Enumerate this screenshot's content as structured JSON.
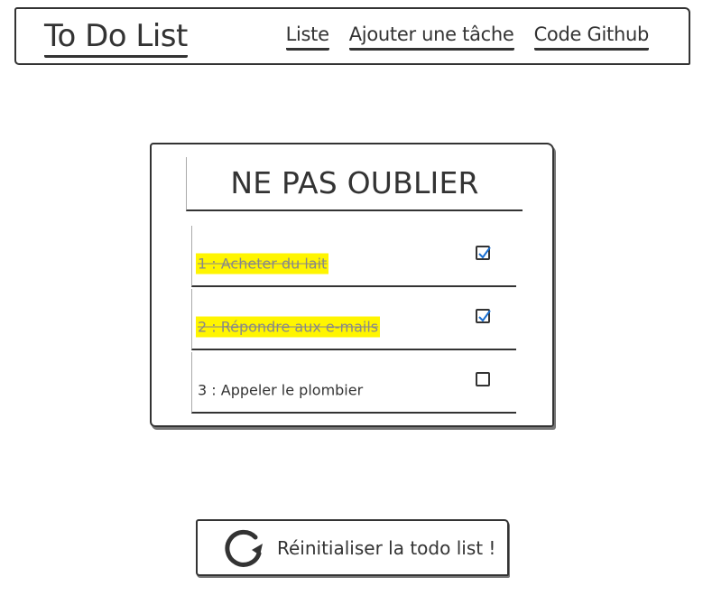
{
  "header": {
    "brand": "To Do List",
    "nav": [
      {
        "label": "Liste"
      },
      {
        "label": "Ajouter une tâche"
      },
      {
        "label": "Code Github"
      }
    ]
  },
  "card": {
    "title": "NE PAS OUBLIER",
    "items": [
      {
        "label": "1 : Acheter du lait",
        "checked": true
      },
      {
        "label": "2 : Répondre aux e-mails",
        "checked": true
      },
      {
        "label": "3 : Appeler le plombier",
        "checked": false
      }
    ]
  },
  "reset": {
    "label": "Réinitialiser la todo list !",
    "icon": "refresh-icon"
  },
  "colors": {
    "highlight": "#fff500",
    "ink": "#333333",
    "check": "#1a6fd1"
  }
}
